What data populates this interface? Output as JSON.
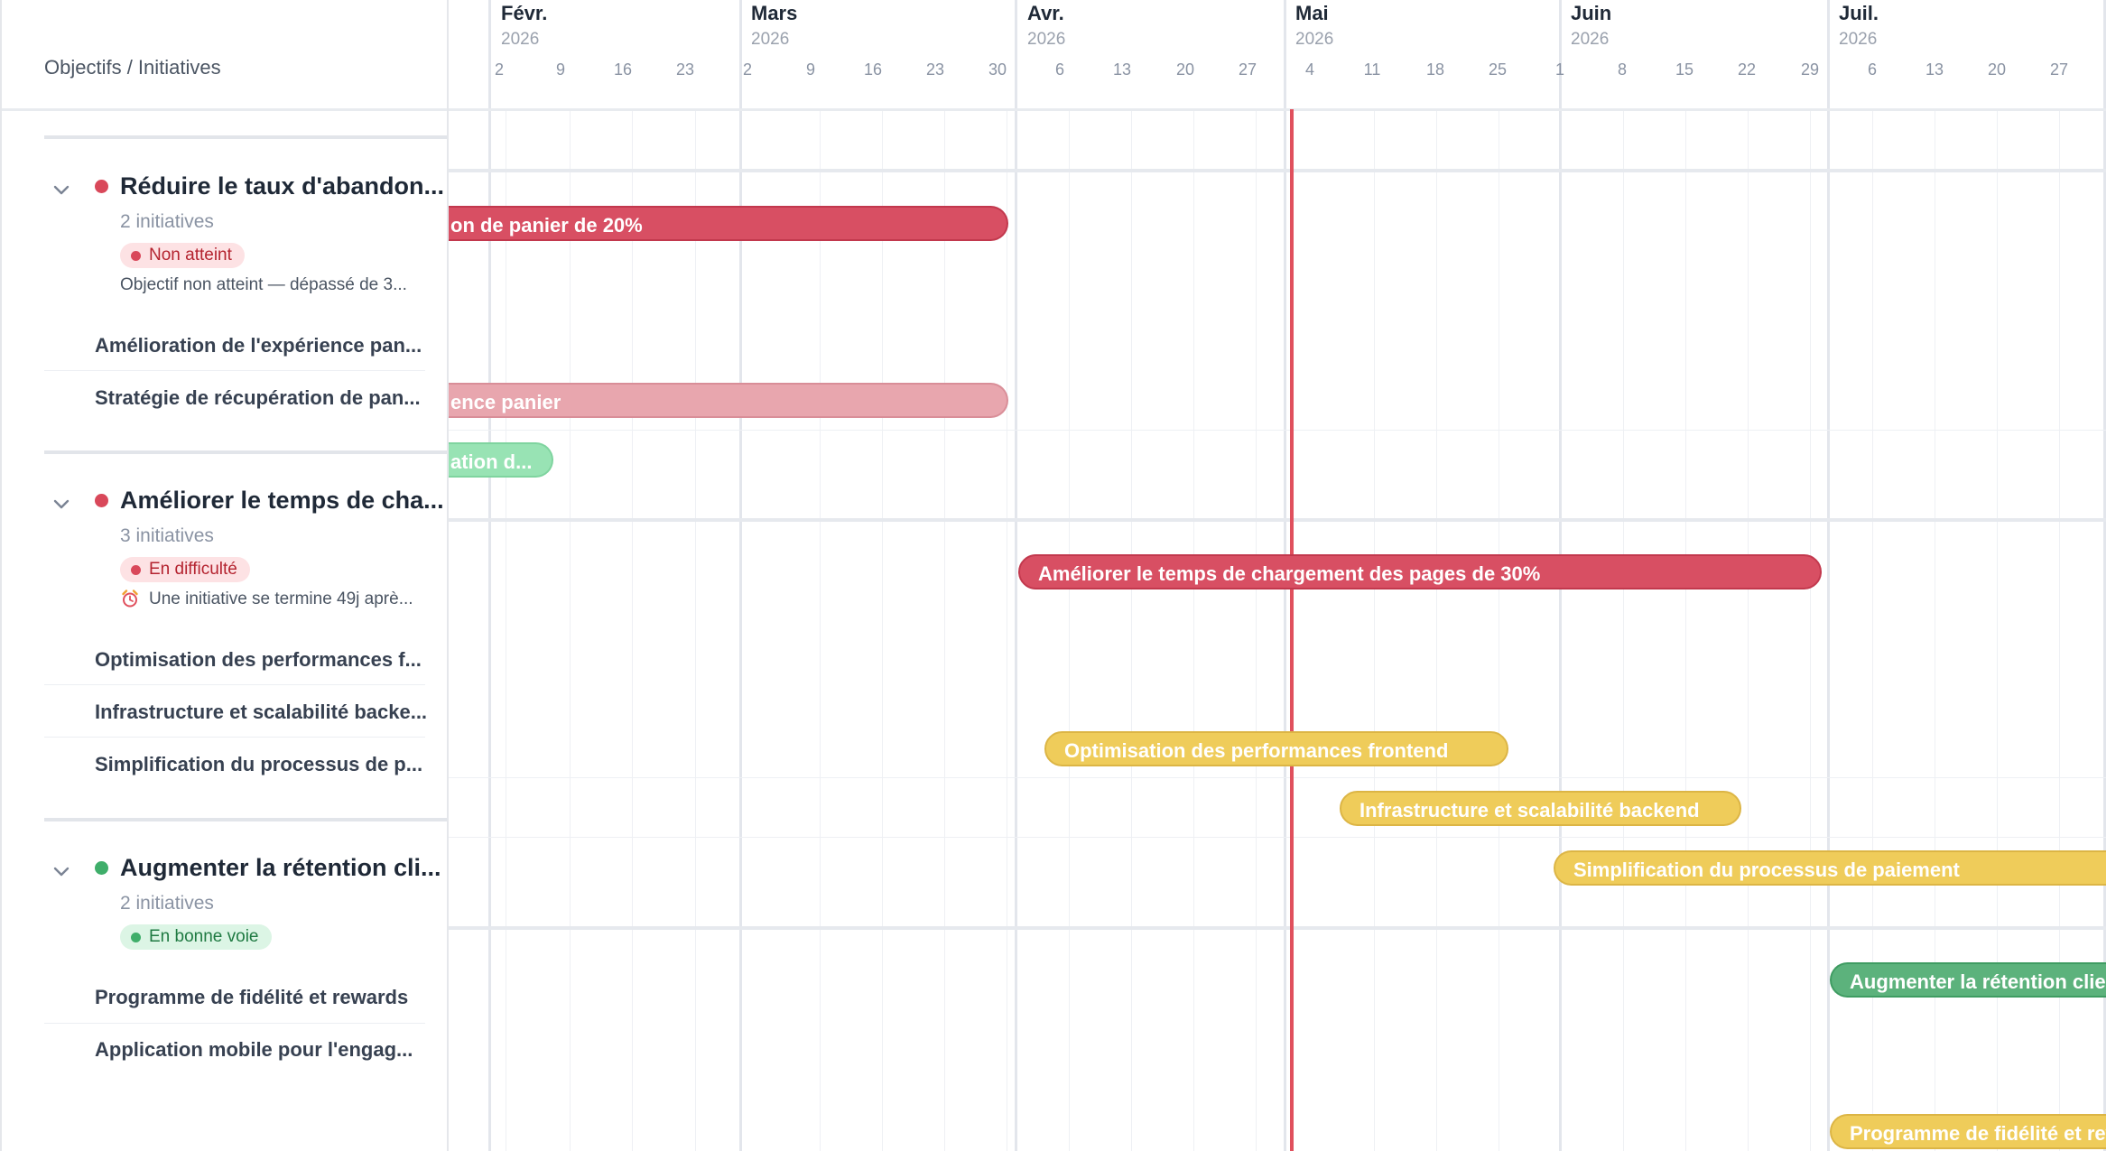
{
  "header": {
    "column_title": "Objectifs / Initiatives",
    "months": [
      {
        "name": "Févr.",
        "year": "2026"
      },
      {
        "name": "Mars",
        "year": "2026"
      },
      {
        "name": "Avr.",
        "year": "2026"
      },
      {
        "name": "Mai",
        "year": "2026"
      },
      {
        "name": "Juin",
        "year": "2026"
      },
      {
        "name": "Juil.",
        "year": "2026"
      }
    ],
    "weeks": [
      "2",
      "9",
      "16",
      "23",
      "2",
      "9",
      "16",
      "23",
      "30",
      "6",
      "13",
      "20",
      "27",
      "4",
      "11",
      "18",
      "25",
      "1",
      "8",
      "15",
      "22",
      "29",
      "6",
      "13",
      "20",
      "27"
    ]
  },
  "objectives": [
    {
      "title": "Réduire le taux d'abandon...",
      "count": "2 initiatives",
      "status": "Non atteint",
      "note": "Objectif non atteint — dépassé de 3...",
      "initiatives": [
        {
          "label": "Amélioration de l'expérience pan..."
        },
        {
          "label": "Stratégie de récupération de pan..."
        }
      ]
    },
    {
      "title": "Améliorer le temps de cha...",
      "count": "3 initiatives",
      "status": "En difficulté",
      "note_icon": "alarm-clock-icon",
      "note": "Une initiative se termine 49j aprè...",
      "initiatives": [
        {
          "label": "Optimisation des performances f..."
        },
        {
          "label": "Infrastructure et scalabilité backe..."
        },
        {
          "label": "Simplification du processus de p..."
        }
      ]
    },
    {
      "title": "Augmenter la rétention cli...",
      "count": "2 initiatives",
      "status": "En bonne voie",
      "initiatives": [
        {
          "label": "Programme de fidélité et rewards"
        },
        {
          "label": "Application mobile pour l'engag..."
        }
      ]
    }
  ],
  "bars": {
    "obj1_bar": "on de panier de 20%",
    "obj1_init1_bar": "ence panier",
    "obj1_init2_bar": "ation d...",
    "obj2_bar": "Améliorer le temps de chargement des pages de 30%",
    "obj2_init1_bar": "Optimisation des performances frontend",
    "obj2_init2_bar": "Infrastructure et scalabilité backend",
    "obj2_init3_bar": "Simplification du processus de paiement",
    "obj3_bar": "Augmenter la rétention clien",
    "obj3_init1_bar": "Programme de fidélité et rew"
  },
  "colors": {
    "red": "#d84f63",
    "light_red": "#e8a6ae",
    "yellow": "#efcc5a",
    "green": "#5cb27c",
    "light_green": "#98e3b4",
    "today_line": "#e0505d"
  }
}
